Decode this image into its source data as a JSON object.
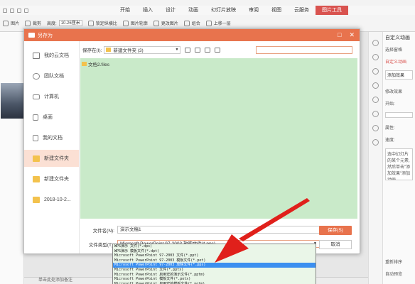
{
  "menu": {
    "tabs": [
      "开始",
      "插入",
      "设计",
      "动画",
      "幻灯片放映",
      "审阅",
      "视图",
      "云服务",
      "图片工具"
    ],
    "active_tab": "图片工具"
  },
  "ribbon": {
    "height_label": "高度:",
    "height_value": "10.26厘米",
    "lock_ratio": "锁定纵横比",
    "picture_outline": "图片轮廓",
    "change_picture": "更改图片",
    "combine": "组合",
    "bring_forward": "上移一层",
    "left_label_1": "图片",
    "left_label_2": "裁剪"
  },
  "dialog": {
    "title": "另存为",
    "btn_min": "□",
    "btn_close": "✕",
    "places": [
      {
        "label": "我的云文档",
        "icon": "cube"
      },
      {
        "label": "团队文档",
        "icon": "cloud"
      },
      {
        "label": "计算机",
        "icon": "monitor"
      },
      {
        "label": "桌面",
        "icon": "doc"
      },
      {
        "label": "我的文档",
        "icon": "doc"
      },
      {
        "label": "新建文件夹",
        "icon": "folder"
      },
      {
        "label": "新建文件夹",
        "icon": "folder"
      },
      {
        "label": "2018-10-2...",
        "icon": "folder"
      }
    ],
    "save_in_label": "保存在(I):",
    "save_in_value": "新建文件夹 (3)",
    "files": [
      "文档2.files"
    ],
    "filename_label": "文件名(N):",
    "filename_value": "演示文稿1",
    "filetype_label": "文件类型(T):",
    "filetype_value": "Microsoft PowerPoint 97-2003 放映文件(*.pps)",
    "save_button": "保存(S)",
    "cancel_button": "取消"
  },
  "dropdown": {
    "options": [
      "WPS演示 文件(*.dps)",
      "WPS演示 模板文件(*.dpt)",
      "Microsoft PowerPoint 97-2003 文件(*.ppt)",
      "Microsoft PowerPoint 97-2003 模板文件(*.pot)",
      "Microsoft PowerPoint 97-2003 放映文件(*.pps)",
      "Microsoft PowerPoint 文件(*.pptx)",
      "Microsoft PowerPoint 启用宏的演示文件(*.pptm)",
      "Microsoft PowerPoint 模板文件(*.potx)",
      "Microsoft PowerPoint 启用宏的模板文件(*.potm)"
    ],
    "selected_index": 4
  },
  "right_panel": {
    "title": "自定义动画",
    "select_pane": "选择窗格",
    "custom_anim": "自定义动画",
    "add_effect": "添加效果",
    "modify_effect": "修改效果",
    "start": "开始:",
    "property": "属性:",
    "speed": "速度:",
    "desc": "选中幻灯片的某个元素,然后单击\"添加效果\"添加动画。",
    "reorder": "重新排序",
    "autopreview": "自动预览"
  },
  "status": {
    "notes": "单击此处添加备注"
  },
  "colors": {
    "accent": "#e8734d",
    "list_bg": "#c9eac9",
    "selected": "#3b8ff0",
    "arrow": "#e0201b"
  }
}
